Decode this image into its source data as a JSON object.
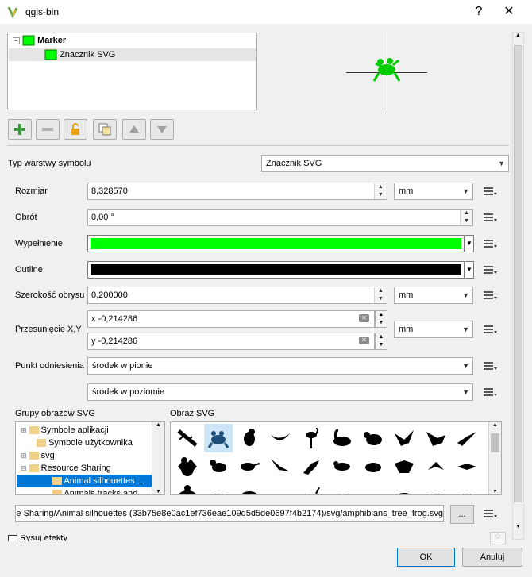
{
  "window": {
    "title": "qgis-bin",
    "help_glyph": "?",
    "close_glyph": "✕"
  },
  "symbol_tree": {
    "root_label": "Marker",
    "child_label": "Znacznik SVG"
  },
  "layer_type": {
    "label": "Typ warstwy symbolu",
    "value": "Znacznik SVG"
  },
  "fields": {
    "size": {
      "label": "Rozmiar",
      "value": "8,328570",
      "unit": "mm"
    },
    "rotation": {
      "label": "Obrót",
      "value": "0,00 °"
    },
    "fill": {
      "label": "Wypełnienie",
      "color": "#00ff00"
    },
    "outline": {
      "label": "Outline",
      "color": "#000000"
    },
    "outline_width": {
      "label": "Szerokość obrysu",
      "value": "0,200000",
      "unit": "mm"
    },
    "offset": {
      "label": "Przesunięcie X,Y",
      "x": "x -0,214286",
      "y": "y -0,214286",
      "unit": "mm"
    },
    "anchor": {
      "label": "Punkt odniesienia",
      "vertical": "środek w pionie",
      "horizontal": "środek w poziomie"
    }
  },
  "svg_groups": {
    "label": "Grupy obrazów SVG",
    "items": [
      "Symbole aplikacji",
      "Symbole użytkownika",
      "svg",
      "Resource Sharing",
      "Animal silhouettes ...",
      "Animals tracks and ..."
    ]
  },
  "svg_images": {
    "label": "Obraz SVG"
  },
  "svg_path": "e Sharing/Animal silhouettes (33b75e8e0ac1ef736eae109d5d5de0697f4b2174)/svg/amphibians_tree_frog.svg",
  "browse_label": "...",
  "effects_label": "Rysuj efekty",
  "buttons": {
    "ok": "OK",
    "cancel": "Anuluj"
  },
  "colors": {
    "accent": "#0078d7",
    "frog": "#00cc00",
    "selected_frog": "#1f4e79"
  }
}
